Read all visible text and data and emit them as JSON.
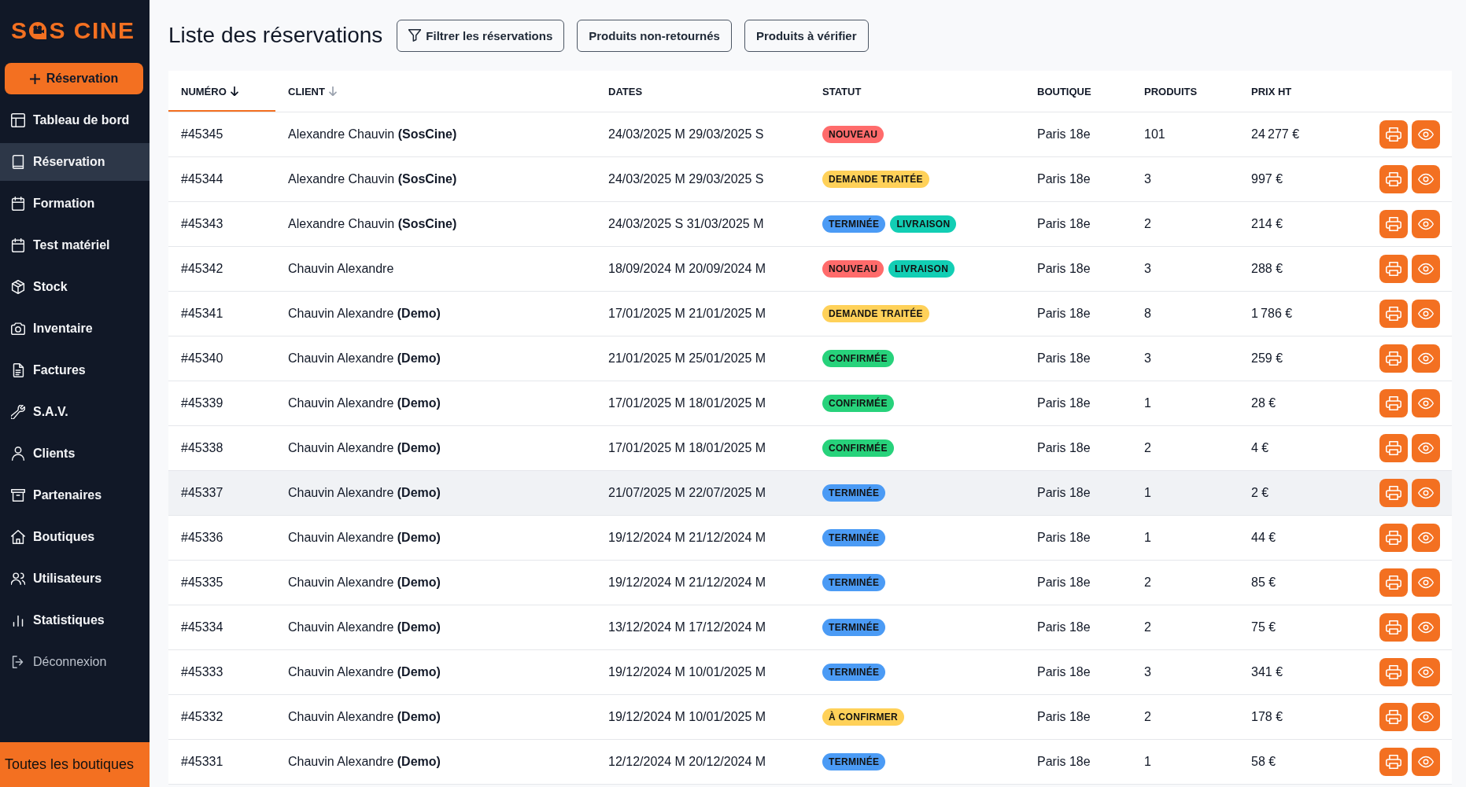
{
  "sidebar": {
    "logo": {
      "text_before_icon": "S",
      "text_after_icon": "S CINE"
    },
    "new_button": {
      "label": "Réservation"
    },
    "nav": [
      {
        "label": "Tableau de bord",
        "selected": false,
        "kind": "link"
      },
      {
        "label": "Réservation",
        "selected": true,
        "kind": "link"
      },
      {
        "label": "Formation",
        "selected": false,
        "kind": "link"
      },
      {
        "label": "Test matériel",
        "selected": false,
        "kind": "link"
      },
      {
        "label": "Stock",
        "selected": false,
        "kind": "link"
      },
      {
        "label": "Inventaire",
        "selected": false,
        "kind": "link"
      },
      {
        "label": "Factures",
        "selected": false,
        "kind": "link"
      },
      {
        "label": "S.A.V.",
        "selected": false,
        "kind": "link"
      },
      {
        "label": "Clients",
        "selected": false,
        "kind": "link"
      },
      {
        "label": "Partenaires",
        "selected": false,
        "kind": "link"
      },
      {
        "label": "Boutiques",
        "selected": false,
        "kind": "link"
      },
      {
        "label": "Utilisateurs",
        "selected": false,
        "kind": "link"
      },
      {
        "label": "Statistiques",
        "selected": false,
        "kind": "link"
      },
      {
        "label": "Déconnexion",
        "selected": false,
        "kind": "logout"
      }
    ],
    "store_selector": {
      "value": "Toutes les boutiques"
    }
  },
  "page": {
    "title": "Liste des réservations",
    "buttons": [
      {
        "label": "Filtrer les réservations",
        "kind": "filter"
      },
      {
        "label": "Produits non-retournés",
        "kind": "plain"
      },
      {
        "label": "Produits à vérifier",
        "kind": "plain"
      }
    ]
  },
  "table": {
    "columns": [
      {
        "label": "NUMÉRO",
        "sortable": true,
        "selected": true
      },
      {
        "label": "CLIENT",
        "sortable": true,
        "selected": false
      },
      {
        "label": "DATES",
        "sortable": false,
        "selected": false
      },
      {
        "label": "STATUT",
        "sortable": false,
        "selected": false
      },
      {
        "label": "BOUTIQUE",
        "sortable": false,
        "selected": false
      },
      {
        "label": "PRODUITS",
        "sortable": false,
        "selected": false
      },
      {
        "label": "PRIX HT",
        "sortable": false,
        "selected": false
      }
    ],
    "rows": [
      {
        "number": "#45345",
        "client": "Alexandre Chauvin **(SosCine)**",
        "dates": "24/03/2025 M 29/03/2025 S",
        "statuses": [
          {
            "label": "NOUVEAU",
            "color": "#ff6b6b"
          }
        ],
        "store": "Paris 18e",
        "products": "101",
        "price": "24 277 €",
        "hovered": false
      },
      {
        "number": "#45344",
        "client": "Alexandre Chauvin **(SosCine)**",
        "dates": "24/03/2025 M 29/03/2025 S",
        "statuses": [
          {
            "label": "DEMANDE TRAITÉE",
            "color": "#ffd159"
          }
        ],
        "store": "Paris 18e",
        "products": "3",
        "price": "997 €",
        "hovered": false
      },
      {
        "number": "#45343",
        "client": "Alexandre Chauvin **(SosCine)**",
        "dates": "24/03/2025 S 31/03/2025 M",
        "statuses": [
          {
            "label": "TERMINÉE",
            "color": "#4b9bf5"
          },
          {
            "label": "LIVRAISON",
            "color": "#12ceb4"
          }
        ],
        "store": "Paris 18e",
        "products": "2",
        "price": "214 €",
        "hovered": false
      },
      {
        "number": "#45342",
        "client": "Chauvin Alexandre",
        "dates": "18/09/2024 M 20/09/2024 M",
        "statuses": [
          {
            "label": "NOUVEAU",
            "color": "#ff6b6b"
          },
          {
            "label": "LIVRAISON",
            "color": "#12ceb4"
          }
        ],
        "store": "Paris 18e",
        "products": "3",
        "price": "288 €",
        "hovered": false
      },
      {
        "number": "#45341",
        "client": "Chauvin Alexandre **(Demo)**",
        "dates": "17/01/2025 M 21/01/2025 M",
        "statuses": [
          {
            "label": "DEMANDE TRAITÉE",
            "color": "#ffd159"
          }
        ],
        "store": "Paris 18e",
        "products": "8",
        "price": "1 786 €",
        "hovered": false
      },
      {
        "number": "#45340",
        "client": "Chauvin Alexandre **(Demo)**",
        "dates": "21/01/2025 M 25/01/2025 M",
        "statuses": [
          {
            "label": "CONFIRMÉE",
            "color": "#27d27b"
          }
        ],
        "store": "Paris 18e",
        "products": "3",
        "price": "259 €",
        "hovered": false
      },
      {
        "number": "#45339",
        "client": "Chauvin Alexandre **(Demo)**",
        "dates": "17/01/2025 M 18/01/2025 M",
        "statuses": [
          {
            "label": "CONFIRMÉE",
            "color": "#27d27b"
          }
        ],
        "store": "Paris 18e",
        "products": "1",
        "price": "28 €",
        "hovered": false
      },
      {
        "number": "#45338",
        "client": "Chauvin Alexandre **(Demo)**",
        "dates": "17/01/2025 M 18/01/2025 M",
        "statuses": [
          {
            "label": "CONFIRMÉE",
            "color": "#27d27b"
          }
        ],
        "store": "Paris 18e",
        "products": "2",
        "price": "4 €",
        "hovered": false
      },
      {
        "number": "#45337",
        "client": "Chauvin Alexandre **(Demo)**",
        "dates": "21/07/2025 M 22/07/2025 M",
        "statuses": [
          {
            "label": "TERMINÉE",
            "color": "#4b9bf5"
          }
        ],
        "store": "Paris 18e",
        "products": "1",
        "price": "2 €",
        "hovered": true
      },
      {
        "number": "#45336",
        "client": "Chauvin Alexandre **(Demo)**",
        "dates": "19/12/2024 M 21/12/2024 M",
        "statuses": [
          {
            "label": "TERMINÉE",
            "color": "#4b9bf5"
          }
        ],
        "store": "Paris 18e",
        "products": "1",
        "price": "44 €",
        "hovered": false
      },
      {
        "number": "#45335",
        "client": "Chauvin Alexandre **(Demo)**",
        "dates": "19/12/2024 M 21/12/2024 M",
        "statuses": [
          {
            "label": "TERMINÉE",
            "color": "#4b9bf5"
          }
        ],
        "store": "Paris 18e",
        "products": "2",
        "price": "85 €",
        "hovered": false
      },
      {
        "number": "#45334",
        "client": "Chauvin Alexandre **(Demo)**",
        "dates": "13/12/2024 M 17/12/2024 M",
        "statuses": [
          {
            "label": "TERMINÉE",
            "color": "#4b9bf5"
          }
        ],
        "store": "Paris 18e",
        "products": "2",
        "price": "75 €",
        "hovered": false
      },
      {
        "number": "#45333",
        "client": "Chauvin Alexandre **(Demo)**",
        "dates": "19/12/2024 M 10/01/2025 M",
        "statuses": [
          {
            "label": "TERMINÉE",
            "color": "#4b9bf5"
          }
        ],
        "store": "Paris 18e",
        "products": "3",
        "price": "341 €",
        "hovered": false
      },
      {
        "number": "#45332",
        "client": "Chauvin Alexandre **(Demo)**",
        "dates": "19/12/2024 M 10/01/2025 M",
        "statuses": [
          {
            "label": "À CONFIRMER",
            "color": "#ffd159"
          }
        ],
        "store": "Paris 18e",
        "products": "2",
        "price": "178 €",
        "hovered": false
      },
      {
        "number": "#45331",
        "client": "Chauvin Alexandre **(Demo)**",
        "dates": "12/12/2024 M 20/12/2024 M",
        "statuses": [
          {
            "label": "TERMINÉE",
            "color": "#4b9bf5"
          }
        ],
        "store": "Paris 18e",
        "products": "1",
        "price": "58 €",
        "hovered": false
      }
    ]
  }
}
